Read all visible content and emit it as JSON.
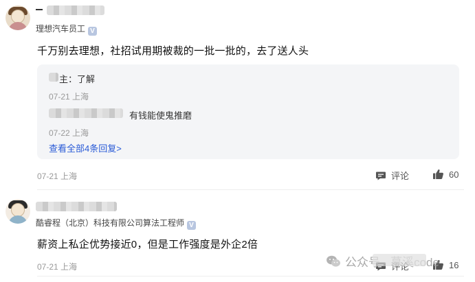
{
  "posts": [
    {
      "author_subtitle": "理想汽车员工",
      "verified_badge": "V",
      "content": "千万别去理想，社招试用期被裁的一批一批的，去了送人头",
      "replies": [
        {
          "text": "主：了解",
          "time": "07-21 上海"
        },
        {
          "text": "有钱能使鬼推磨",
          "time": "07-22 上海"
        }
      ],
      "view_all_label": "查看全部4条回复>",
      "time": "07-21 上海",
      "comment_label": "评论",
      "like_count": "60"
    },
    {
      "author_subtitle": "酷睿程（北京）科技有限公司算法工程师",
      "verified_badge": "V",
      "content": "薪资上私企优势接近0，但是工作强度是外企2倍",
      "time": "07-21 上海",
      "comment_label": "评论",
      "like_count": "16"
    }
  ],
  "watermark": "公众号 · 慕溪code"
}
